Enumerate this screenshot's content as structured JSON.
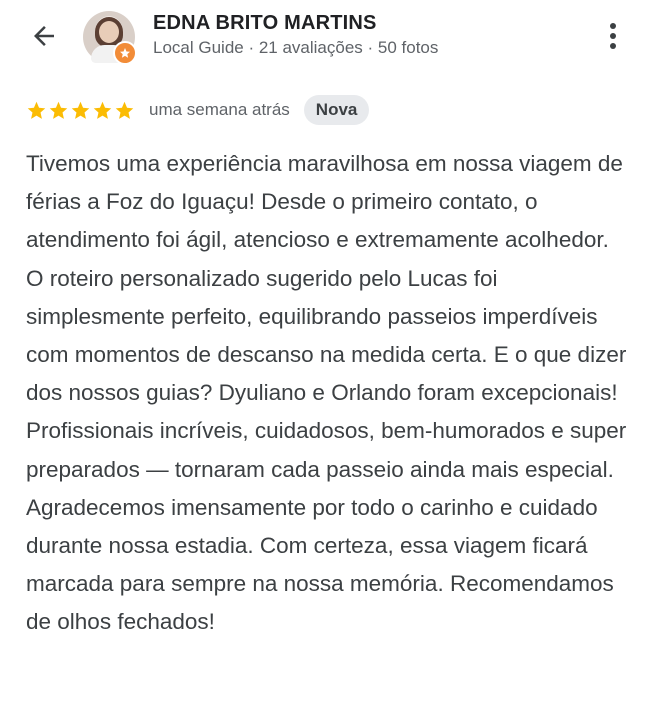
{
  "header": {
    "reviewer_name": "EDNA BRITO MARTINS",
    "reviewer_meta": "Local Guide · 21 avaliações · 50 fotos"
  },
  "review": {
    "rating": 5,
    "rating_max": 5,
    "time": "uma semana atrás",
    "badge": "Nova",
    "paragraph_1": "Tivemos uma experiência maravilhosa em nossa viagem de férias a Foz do Iguaçu! Desde o primeiro contato, o atendimento foi ágil, atencioso e extremamente acolhedor.",
    "paragraph_2": "O roteiro personalizado sugerido pelo Lucas foi simplesmente perfeito, equilibrando passeios imperdíveis com momentos de descanso na medida certa. E o que dizer dos nossos guias? Dyuliano e Orlando foram excepcionais! Profissionais incríveis, cuidadosos, bem-humorados e super preparados — tornaram cada passeio ainda mais especial. Agradecemos imensamente por todo o carinho e cuidado durante nossa estadia. Com certeza, essa viagem ficará marcada para sempre na nossa memória. Recomendamos de olhos fechados!"
  },
  "colors": {
    "star": "#fbbc04",
    "badge_bg": "#e8eaed",
    "local_guide_badge": "#f28c38"
  },
  "icons": {
    "back": "arrow-back-icon",
    "more": "more-vert-icon",
    "star": "star-icon",
    "guide": "local-guide-star-icon"
  }
}
